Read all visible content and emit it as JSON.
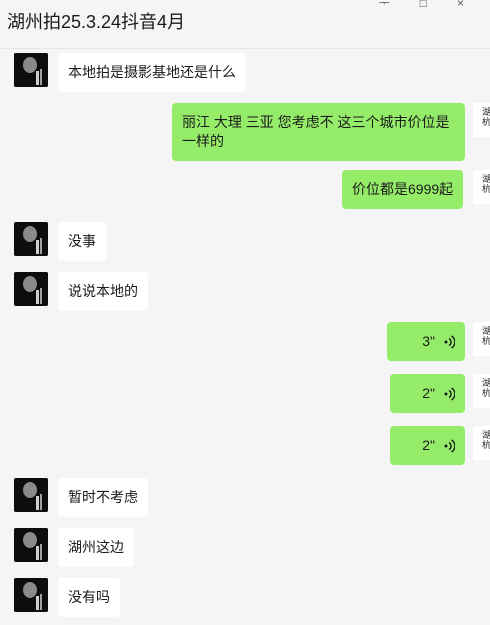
{
  "header": {
    "title": "湖州拍25.3.24抖音4月",
    "controls": [
      "ᅮ",
      "□",
      "×"
    ]
  },
  "messages": [
    {
      "side": "left",
      "text": "本地拍是摄影基地还是什么"
    },
    {
      "side": "right",
      "text": "丽江 大理  三亚 您考虑不 这三个城市价位是一样的"
    },
    {
      "side": "right",
      "text": "价位都是6999起"
    },
    {
      "side": "left",
      "text": "没事"
    },
    {
      "side": "left",
      "text": "说说本地的"
    },
    {
      "side": "right",
      "type": "voice",
      "duration": "3\""
    },
    {
      "side": "right",
      "type": "voice",
      "duration": "2\""
    },
    {
      "side": "right",
      "type": "voice",
      "duration": "2\""
    },
    {
      "side": "left",
      "text": "暂时不考虑"
    },
    {
      "side": "left",
      "text": "湖州这边"
    },
    {
      "side": "left",
      "text": "没有吗"
    }
  ],
  "self_avatar_text": "湖\n杭",
  "icons": {
    "voice": "voice-wave-icon"
  },
  "colors": {
    "background": "#f5f5f5",
    "bubble_incoming": "#ffffff",
    "bubble_outgoing": "#95ec69"
  }
}
